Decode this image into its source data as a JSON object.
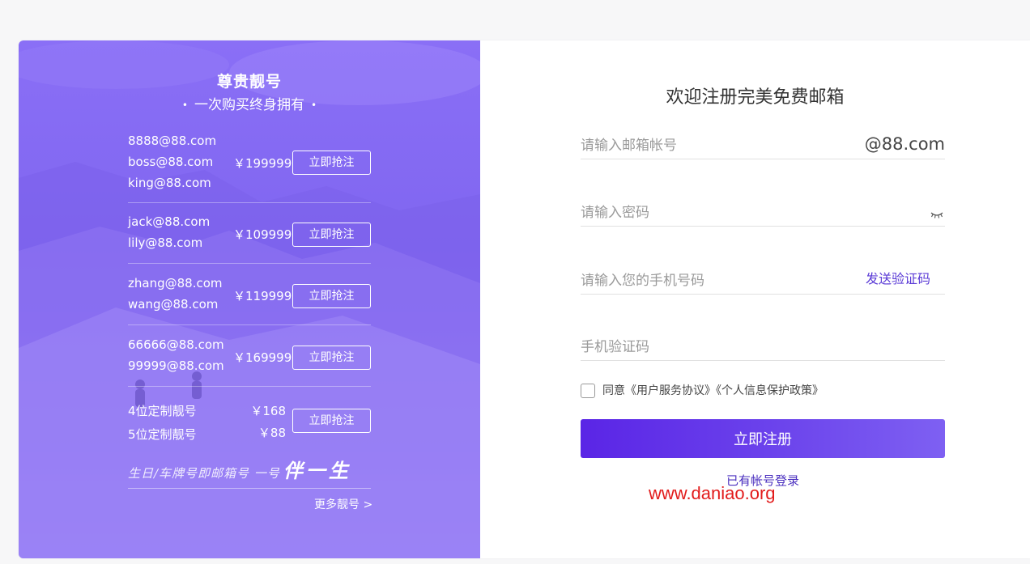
{
  "promo": {
    "title": "尊贵靓号",
    "subtitle_dot": "•",
    "subtitle": "一次购买终身拥有",
    "groups": [
      {
        "emails": [
          "8888@88.com",
          "boss@88.com",
          "king@88.com"
        ],
        "price": "￥199999",
        "button": "立即抢注"
      },
      {
        "emails": [
          "jack@88.com",
          "lily@88.com"
        ],
        "price": "￥109999",
        "button": "立即抢注"
      },
      {
        "emails": [
          "zhang@88.com",
          "wang@88.com"
        ],
        "price": "￥119999",
        "button": "立即抢注"
      },
      {
        "emails": [
          "66666@88.com",
          "99999@88.com"
        ],
        "price": "￥169999",
        "button": "立即抢注"
      }
    ],
    "custom": {
      "row1_label": "4位定制靓号",
      "row1_price": "￥168",
      "row2_label": "5位定制靓号",
      "row2_price": "￥88",
      "button": "立即抢注"
    },
    "slogan_small": "生日/车牌号即邮箱号 一号",
    "slogan_big": "伴一生",
    "more": "更多靓号 >"
  },
  "form": {
    "title": "欢迎注册完美免费邮箱",
    "email_placeholder": "请输入邮箱帐号",
    "email_suffix": "@88.com",
    "password_placeholder": "请输入密码",
    "phone_placeholder": "请输入您的手机号码",
    "send_code": "发送验证码",
    "code_placeholder": "手机验证码",
    "agree_text": "同意《用户服务协议》《个人信息保护政策》",
    "submit": "立即注册",
    "login_link": "已有帐号登录"
  },
  "watermark": "www.daniao.org",
  "colors": {
    "accent": "#5a25e6",
    "promo_bg": "#8a6ff6",
    "link": "#4a2fbf",
    "watermark": "#e21b1b"
  }
}
